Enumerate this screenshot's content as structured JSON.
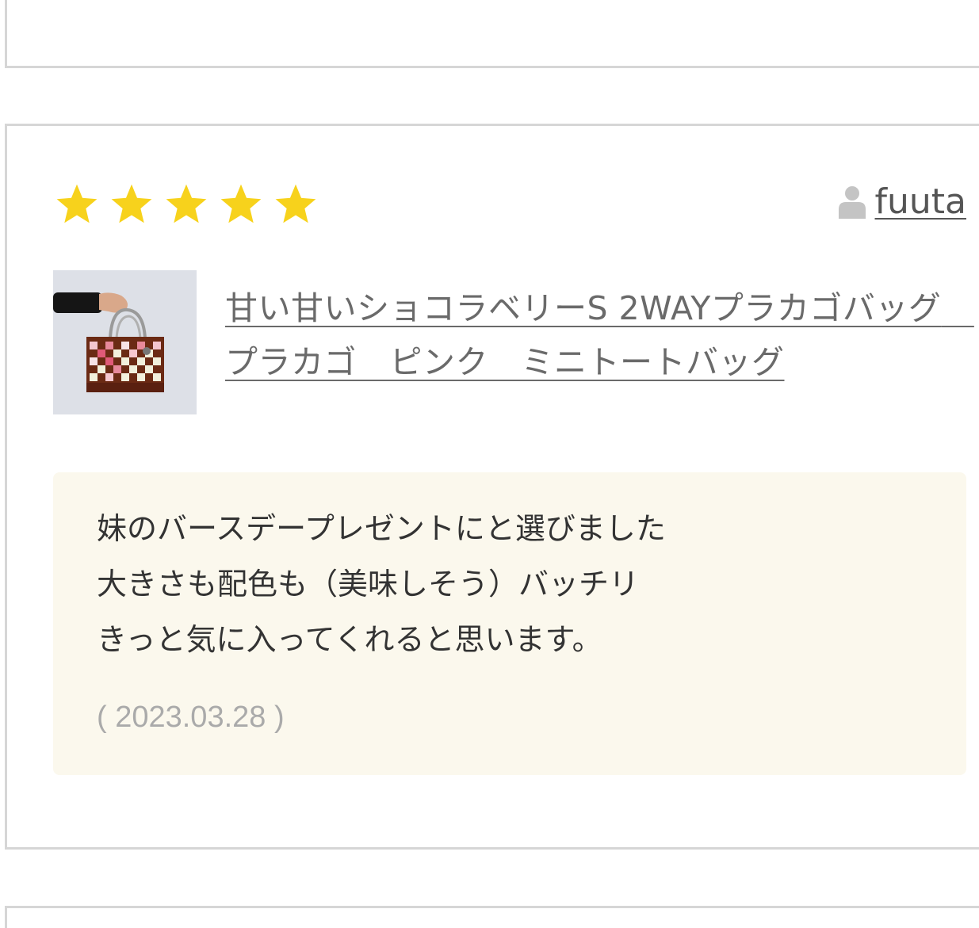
{
  "review": {
    "rating": 5,
    "rating_max": 5,
    "star_color": "#f7d21c",
    "reviewer_name": "fuuta",
    "product_title": "甘い甘いショコラベリーS 2WAYプラカゴバッグ　プラカゴ　ピンク　ミニトートバッグ",
    "comment": "妹のバースデープレゼントにと選びました\n大きさも配色も（美味しそう）バッチリ\nきっと気に入ってくれると思います。",
    "date": "( 2023.03.28 )"
  },
  "icons": {
    "star": "star-icon",
    "user": "user-icon"
  },
  "colors": {
    "comment_bg": "#fbf8ed",
    "border": "#d6d6d6"
  }
}
